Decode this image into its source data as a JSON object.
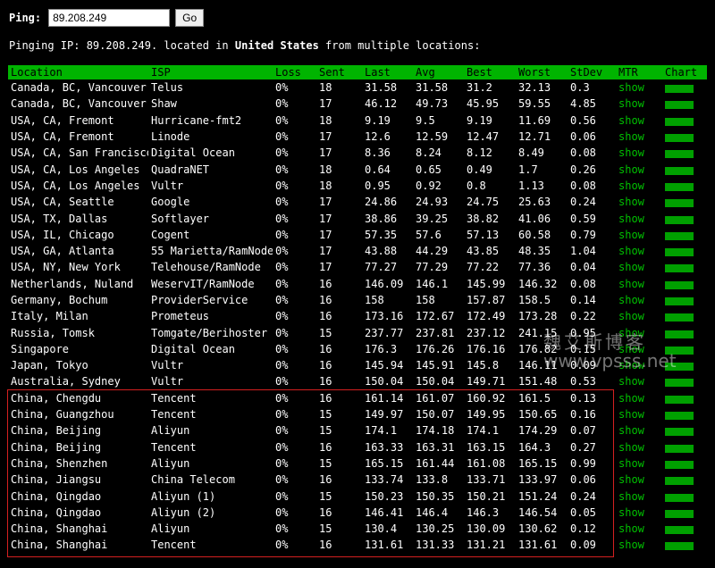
{
  "ping_form": {
    "label": "Ping:",
    "input_value": "89.208.249",
    "button_label": "Go"
  },
  "pinging_line": {
    "prefix": "Pinging IP: 89.208.249.",
    "middle": " located in ",
    "country": "United States",
    "suffix": " from multiple locations:"
  },
  "columns": [
    "Location",
    "ISP",
    "Loss",
    "Sent",
    "Last",
    "Avg",
    "Best",
    "Worst",
    "StDev",
    "MTR",
    "Chart"
  ],
  "rows": [
    {
      "location": "Canada, BC, Vancouver",
      "isp": "Telus",
      "loss": "0%",
      "sent": "18",
      "last": "31.58",
      "avg": "31.58",
      "best": "31.2",
      "worst": "32.13",
      "stdev": "0.3",
      "mtr": "show"
    },
    {
      "location": "Canada, BC, Vancouver",
      "isp": "Shaw",
      "loss": "0%",
      "sent": "17",
      "last": "46.12",
      "avg": "49.73",
      "best": "45.95",
      "worst": "59.55",
      "stdev": "4.85",
      "mtr": "show"
    },
    {
      "location": "USA, CA, Fremont",
      "isp": "Hurricane-fmt2",
      "loss": "0%",
      "sent": "18",
      "last": "9.19",
      "avg": "9.5",
      "best": "9.19",
      "worst": "11.69",
      "stdev": "0.56",
      "mtr": "show"
    },
    {
      "location": "USA, CA, Fremont",
      "isp": "Linode",
      "loss": "0%",
      "sent": "17",
      "last": "12.6",
      "avg": "12.59",
      "best": "12.47",
      "worst": "12.71",
      "stdev": "0.06",
      "mtr": "show"
    },
    {
      "location": "USA, CA, San Francisco",
      "isp": "Digital Ocean",
      "loss": "0%",
      "sent": "17",
      "last": "8.36",
      "avg": "8.24",
      "best": "8.12",
      "worst": "8.49",
      "stdev": "0.08",
      "mtr": "show"
    },
    {
      "location": "USA, CA, Los Angeles",
      "isp": "QuadraNET",
      "loss": "0%",
      "sent": "18",
      "last": "0.64",
      "avg": "0.65",
      "best": "0.49",
      "worst": "1.7",
      "stdev": "0.26",
      "mtr": "show"
    },
    {
      "location": "USA, CA, Los Angeles",
      "isp": "Vultr",
      "loss": "0%",
      "sent": "18",
      "last": "0.95",
      "avg": "0.92",
      "best": "0.8",
      "worst": "1.13",
      "stdev": "0.08",
      "mtr": "show"
    },
    {
      "location": "USA, CA, Seattle",
      "isp": "Google",
      "loss": "0%",
      "sent": "17",
      "last": "24.86",
      "avg": "24.93",
      "best": "24.75",
      "worst": "25.63",
      "stdev": "0.24",
      "mtr": "show"
    },
    {
      "location": "USA, TX, Dallas",
      "isp": "Softlayer",
      "loss": "0%",
      "sent": "17",
      "last": "38.86",
      "avg": "39.25",
      "best": "38.82",
      "worst": "41.06",
      "stdev": "0.59",
      "mtr": "show"
    },
    {
      "location": "USA, IL, Chicago",
      "isp": "Cogent",
      "loss": "0%",
      "sent": "17",
      "last": "57.35",
      "avg": "57.6",
      "best": "57.13",
      "worst": "60.58",
      "stdev": "0.79",
      "mtr": "show"
    },
    {
      "location": "USA, GA, Atlanta",
      "isp": "55 Marietta/RamNode",
      "loss": "0%",
      "sent": "17",
      "last": "43.88",
      "avg": "44.29",
      "best": "43.85",
      "worst": "48.35",
      "stdev": "1.04",
      "mtr": "show"
    },
    {
      "location": "USA, NY, New York",
      "isp": "Telehouse/RamNode",
      "loss": "0%",
      "sent": "17",
      "last": "77.27",
      "avg": "77.29",
      "best": "77.22",
      "worst": "77.36",
      "stdev": "0.04",
      "mtr": "show"
    },
    {
      "location": "Netherlands, Nuland",
      "isp": "WeservIT/RamNode",
      "loss": "0%",
      "sent": "16",
      "last": "146.09",
      "avg": "146.1",
      "best": "145.99",
      "worst": "146.32",
      "stdev": "0.08",
      "mtr": "show"
    },
    {
      "location": "Germany, Bochum",
      "isp": "ProviderService",
      "loss": "0%",
      "sent": "16",
      "last": "158",
      "avg": "158",
      "best": "157.87",
      "worst": "158.5",
      "stdev": "0.14",
      "mtr": "show"
    },
    {
      "location": "Italy, Milan",
      "isp": "Prometeus",
      "loss": "0%",
      "sent": "16",
      "last": "173.16",
      "avg": "172.67",
      "best": "172.49",
      "worst": "173.28",
      "stdev": "0.22",
      "mtr": "show"
    },
    {
      "location": "Russia, Tomsk",
      "isp": "Tomgate/Berihoster",
      "loss": "0%",
      "sent": "15",
      "last": "237.77",
      "avg": "237.81",
      "best": "237.12",
      "worst": "241.15",
      "stdev": "0.95",
      "mtr": "show"
    },
    {
      "location": "Singapore",
      "isp": "Digital Ocean",
      "loss": "0%",
      "sent": "16",
      "last": "176.3",
      "avg": "176.26",
      "best": "176.16",
      "worst": "176.82",
      "stdev": "0.15",
      "mtr": "show"
    },
    {
      "location": "Japan, Tokyo",
      "isp": "Vultr",
      "loss": "0%",
      "sent": "16",
      "last": "145.94",
      "avg": "145.91",
      "best": "145.8",
      "worst": "146.11",
      "stdev": "0.09",
      "mtr": "show"
    },
    {
      "location": "Australia, Sydney",
      "isp": "Vultr",
      "loss": "0%",
      "sent": "16",
      "last": "150.04",
      "avg": "150.04",
      "best": "149.71",
      "worst": "151.48",
      "stdev": "0.53",
      "mtr": "show"
    },
    {
      "location": "China, Chengdu",
      "isp": "Tencent",
      "loss": "0%",
      "sent": "16",
      "last": "161.14",
      "avg": "161.07",
      "best": "160.92",
      "worst": "161.5",
      "stdev": "0.13",
      "mtr": "show"
    },
    {
      "location": "China, Guangzhou",
      "isp": "Tencent",
      "loss": "0%",
      "sent": "15",
      "last": "149.97",
      "avg": "150.07",
      "best": "149.95",
      "worst": "150.65",
      "stdev": "0.16",
      "mtr": "show"
    },
    {
      "location": "China, Beijing",
      "isp": "Aliyun",
      "loss": "0%",
      "sent": "15",
      "last": "174.1",
      "avg": "174.18",
      "best": "174.1",
      "worst": "174.29",
      "stdev": "0.07",
      "mtr": "show"
    },
    {
      "location": "China, Beijing",
      "isp": "Tencent",
      "loss": "0%",
      "sent": "16",
      "last": "163.33",
      "avg": "163.31",
      "best": "163.15",
      "worst": "164.3",
      "stdev": "0.27",
      "mtr": "show"
    },
    {
      "location": "China, Shenzhen",
      "isp": "Aliyun",
      "loss": "0%",
      "sent": "15",
      "last": "165.15",
      "avg": "161.44",
      "best": "161.08",
      "worst": "165.15",
      "stdev": "0.99",
      "mtr": "show"
    },
    {
      "location": "China, Jiangsu",
      "isp": "China Telecom",
      "loss": "0%",
      "sent": "16",
      "last": "133.74",
      "avg": "133.8",
      "best": "133.71",
      "worst": "133.97",
      "stdev": "0.06",
      "mtr": "show"
    },
    {
      "location": "China, Qingdao",
      "isp": "Aliyun (1)",
      "loss": "0%",
      "sent": "15",
      "last": "150.23",
      "avg": "150.35",
      "best": "150.21",
      "worst": "151.24",
      "stdev": "0.24",
      "mtr": "show"
    },
    {
      "location": "China, Qingdao",
      "isp": "Aliyun (2)",
      "loss": "0%",
      "sent": "16",
      "last": "146.41",
      "avg": "146.4",
      "best": "146.3",
      "worst": "146.54",
      "stdev": "0.05",
      "mtr": "show"
    },
    {
      "location": "China, Shanghai",
      "isp": "Aliyun",
      "loss": "0%",
      "sent": "15",
      "last": "130.4",
      "avg": "130.25",
      "best": "130.09",
      "worst": "130.62",
      "stdev": "0.12",
      "mtr": "show"
    },
    {
      "location": "China, Shanghai",
      "isp": "Tencent",
      "loss": "0%",
      "sent": "16",
      "last": "131.61",
      "avg": "131.33",
      "best": "131.21",
      "worst": "131.61",
      "stdev": "0.09",
      "mtr": "show"
    }
  ],
  "watermark": {
    "cn": "魏艾斯博客",
    "url": "www.vpsss.net"
  },
  "colors": {
    "header_bg": "#00b400",
    "link": "#00c000",
    "highlight_border": "#d42020"
  }
}
